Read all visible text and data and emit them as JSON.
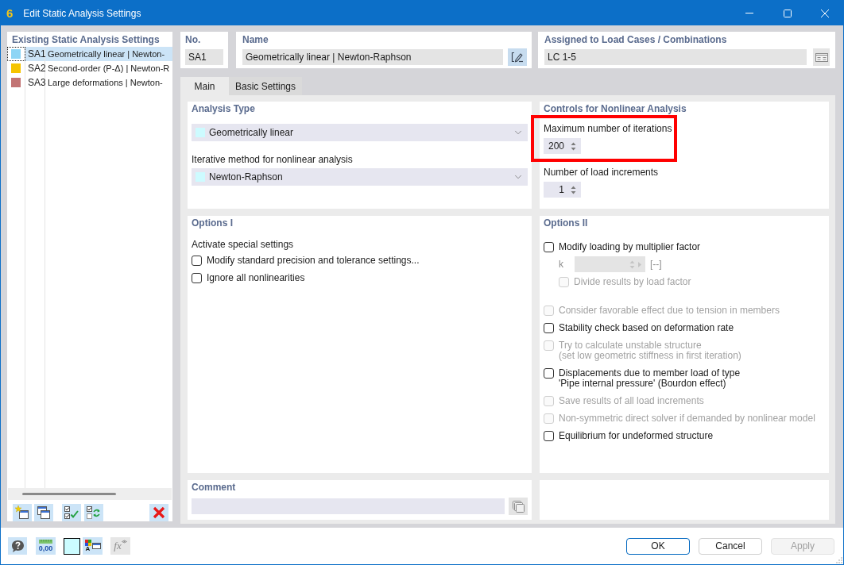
{
  "window": {
    "logo": "6",
    "title": "Edit Static Analysis Settings"
  },
  "list": {
    "header": "Existing Static Analysis Settings",
    "items": [
      {
        "number": "SA1",
        "name": "Geometrically linear | Newton-",
        "color": "#8ed5f5",
        "selected": true
      },
      {
        "number": "SA2",
        "name": "Second-order (P-Δ) | Newton-R",
        "color": "#f5c400",
        "selected": false
      },
      {
        "number": "SA3",
        "name": "Large deformations | Newton-",
        "color": "#c27474",
        "selected": false
      }
    ]
  },
  "list_toolbar": [
    {
      "kind": "new"
    },
    {
      "kind": "copy"
    },
    {
      "kind": "check_all"
    },
    {
      "kind": "toggle"
    },
    {
      "kind": "delete"
    }
  ],
  "number_box": {
    "label": "No.",
    "value": "SA1"
  },
  "name_box": {
    "label": "Name",
    "value": "Geometrically linear | Newton-Raphson"
  },
  "assigned_box": {
    "label": "Assigned to Load Cases / Combinations",
    "value": "LC 1-5"
  },
  "tabs": [
    {
      "label": "Main",
      "selected": true
    },
    {
      "label": "Basic Settings",
      "selected": false
    }
  ],
  "analysis_type": {
    "title": "Analysis Type",
    "type_value": "Geometrically linear",
    "method_label": "Iterative method for nonlinear analysis",
    "method_value": "Newton-Raphson"
  },
  "controls": {
    "title": "Controls for Nonlinear Analysis",
    "fields": [
      {
        "label": "Maximum number of iterations",
        "value": "200",
        "highlighted": true
      },
      {
        "label": "Number of load increments",
        "value": "1",
        "highlighted": false
      }
    ]
  },
  "options_1": {
    "title": "Options I",
    "subtitle": "Activate special settings",
    "items": [
      {
        "kind": "checkbox",
        "label": "Modify standard precision and tolerance settings...",
        "checked": false,
        "disabled": false
      },
      {
        "kind": "checkbox",
        "label": "Ignore all nonlinearities",
        "checked": false,
        "disabled": false
      }
    ]
  },
  "options_2": {
    "title": "Options II",
    "items": [
      {
        "kind": "checkbox",
        "label": "Modify loading by multiplier factor",
        "checked": false,
        "disabled": false,
        "children": [
          {
            "kind": "number",
            "label": "k",
            "unit": "[--]",
            "disabled": true
          },
          {
            "kind": "checkbox",
            "label": "Divide results by load factor",
            "checked": false,
            "disabled": true
          }
        ]
      },
      {
        "kind": "checkbox",
        "label": "Consider favorable effect due to tension in members",
        "checked": false,
        "disabled": true
      },
      {
        "kind": "checkbox",
        "label": "Stability check based on deformation rate",
        "checked": false,
        "disabled": false
      },
      {
        "kind": "checkbox",
        "label": "Try to calculate unstable structure\n(set low geometric stiffness in first iteration)",
        "checked": false,
        "disabled": true
      },
      {
        "kind": "checkbox",
        "label": "Displacements due to member load of type\n'Pipe internal pressure' (Bourdon effect)",
        "checked": false,
        "disabled": false
      },
      {
        "kind": "checkbox",
        "label": "Save results of all load increments",
        "checked": false,
        "disabled": true
      },
      {
        "kind": "checkbox",
        "label": "Non-symmetric direct solver if demanded by nonlinear model",
        "checked": false,
        "disabled": true
      },
      {
        "kind": "checkbox",
        "label": "Equilibrium for undeformed structure",
        "checked": false,
        "disabled": false
      }
    ]
  },
  "comment": {
    "label": "Comment"
  },
  "bottom_tools": [
    {
      "kind": "help",
      "disabled": false
    },
    {
      "kind": "decimals",
      "label": "0,00",
      "disabled": false
    },
    {
      "kind": "color",
      "disabled": false
    },
    {
      "kind": "display",
      "label": "A",
      "disabled": false
    },
    {
      "kind": "formula",
      "label": "fx",
      "disabled": true
    }
  ],
  "buttons": [
    {
      "label": "OK",
      "default": true,
      "disabled": false
    },
    {
      "label": "Cancel",
      "default": false,
      "disabled": false
    },
    {
      "label": "Apply",
      "default": false,
      "disabled": true
    }
  ]
}
